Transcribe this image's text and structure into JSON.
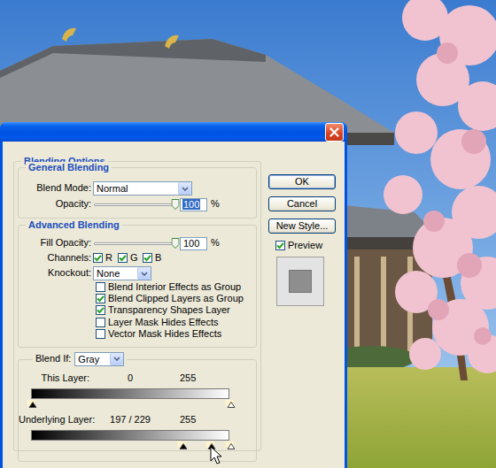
{
  "dialog": {
    "heading": "Blending Options",
    "general_blending": {
      "title": "General Blending",
      "blend_mode": {
        "label": "Blend Mode:",
        "value": "Normal"
      },
      "opacity": {
        "label": "Opacity:",
        "value": "100",
        "unit": "%",
        "level": 1,
        "selected": true
      }
    },
    "advanced_blending": {
      "title": "Advanced Blending",
      "fill_opacity": {
        "label": "Fill Opacity:",
        "value": "100",
        "unit": "%",
        "level": 1,
        "selected": false
      },
      "channels": {
        "label": "Channels:",
        "items": [
          {
            "label": "R",
            "checked": true
          },
          {
            "label": "G",
            "checked": true
          },
          {
            "label": "B",
            "checked": true
          }
        ]
      },
      "knockout": {
        "label": "Knockout:",
        "value": "None"
      },
      "options": [
        {
          "label": "Blend Interior Effects as Group",
          "checked": false
        },
        {
          "label": "Blend Clipped Layers as Group",
          "checked": true
        },
        {
          "label": "Transparency Shapes Layer",
          "checked": true
        },
        {
          "label": "Layer Mask Hides Effects",
          "checked": false
        },
        {
          "label": "Vector Mask Hides Effects",
          "checked": false
        }
      ]
    },
    "blend_if": {
      "label": "Blend If:",
      "value": "Gray",
      "layers": [
        {
          "label": "This Layer:",
          "low": "0",
          "high": "255",
          "markers": [
            {
              "level": 0,
              "color": "#000000"
            },
            {
              "level": 1,
              "color": "#ffffff"
            }
          ]
        },
        {
          "label": "Underlying Layer:",
          "low": "197 / 229",
          "high": "255",
          "markers": [
            {
              "level": 0.76,
              "color": "#000000"
            },
            {
              "level": 0.9,
              "color": "#000000"
            },
            {
              "level": 1,
              "color": "#ffffff"
            }
          ]
        }
      ]
    }
  },
  "buttons": [
    {
      "label": "OK",
      "default": true
    },
    {
      "label": "Cancel",
      "default": false
    },
    {
      "label": "New Style...",
      "default": false
    }
  ],
  "preview": {
    "label": "Preview",
    "checked": true
  }
}
